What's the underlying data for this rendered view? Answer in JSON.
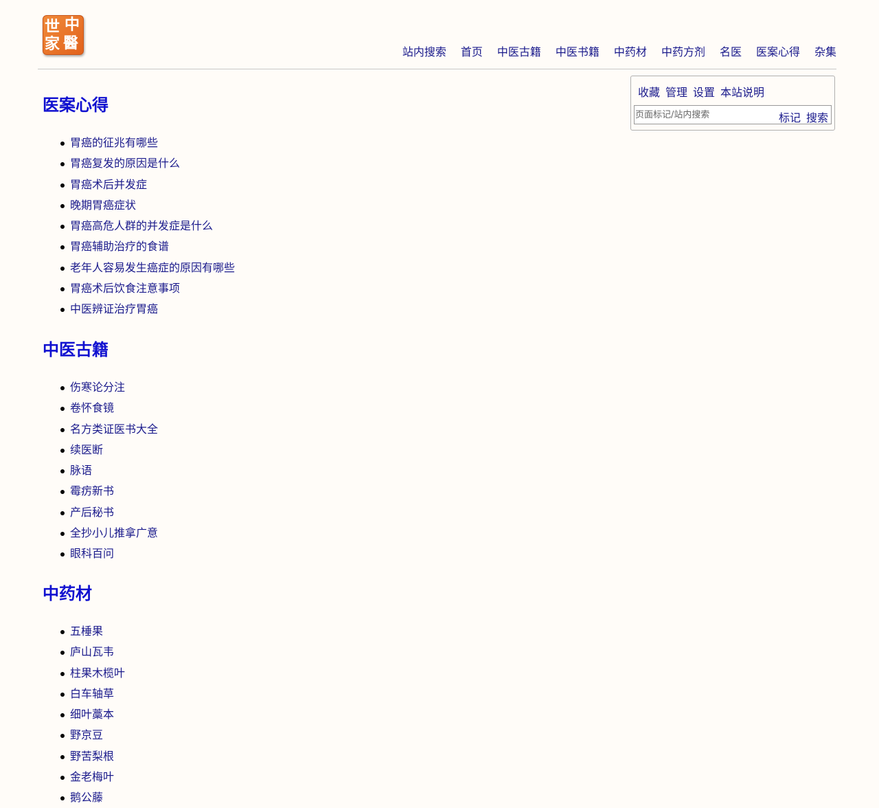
{
  "logo": {
    "chars": [
      "中",
      "世",
      "醫",
      "家"
    ]
  },
  "nav": [
    "站内搜索",
    "首页",
    "中医古籍",
    "中医书籍",
    "中药材",
    "中药方剂",
    "名医",
    "医案心得",
    "杂集"
  ],
  "panel": {
    "links": [
      "收藏",
      "管理",
      "设置",
      "本站说明"
    ],
    "search_placeholder": "页面标记/站内搜索",
    "mark_label": "标记",
    "search_label": "搜索"
  },
  "sections": [
    {
      "title": "医案心得",
      "items": [
        "胃癌的征兆有哪些",
        "胃癌复发的原因是什么",
        "胃癌术后并发症",
        "晚期胃癌症状",
        "胃癌高危人群的并发症是什么",
        "胃癌辅助治疗的食谱",
        "老年人容易发生癌症的原因有哪些",
        "胃癌术后饮食注意事项",
        "中医辨证治疗胃癌"
      ]
    },
    {
      "title": "中医古籍",
      "items": [
        "伤寒论分注",
        "卷怀食镜",
        "名方类证医书大全",
        "续医断",
        "脉语",
        "霉疠新书",
        "产后秘书",
        "全抄小儿推拿广意",
        "眼科百问"
      ]
    },
    {
      "title": "中药材",
      "items": [
        "五棰果",
        "庐山瓦韦",
        "柱果木榄叶",
        "白车轴草",
        "细叶藁本",
        "野京豆",
        "野苦梨根",
        "金老梅叶",
        "鹅公藤"
      ]
    }
  ]
}
